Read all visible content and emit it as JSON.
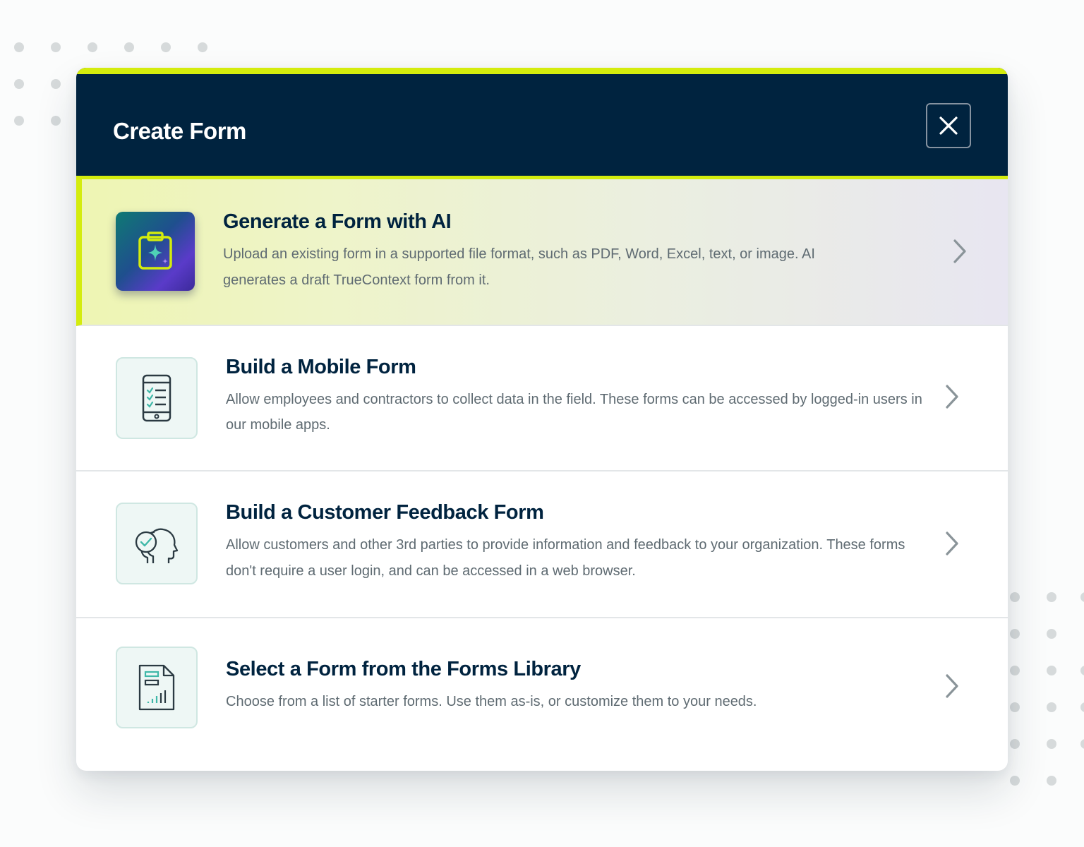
{
  "modal": {
    "title": "Create Form",
    "close_icon": "close-icon"
  },
  "options": [
    {
      "title": "Generate a Form with AI",
      "description": "Upload an existing form in a supported file format, such as PDF, Word, Excel, text, or image. AI generates a draft TrueContext form from it.",
      "icon": "ai-clipboard-sparkle-icon"
    },
    {
      "title": "Build a Mobile Form",
      "description": "Allow employees and contractors to collect data in the field. These forms can be accessed by logged-in users in our mobile apps.",
      "icon": "mobile-checklist-icon"
    },
    {
      "title": "Build a Customer Feedback Form",
      "description": "Allow customers and other 3rd parties to provide information and feedback to your organization. These forms don't require a user login, and can be accessed in a web browser.",
      "icon": "customer-feedback-icon"
    },
    {
      "title": "Select a Form from the Forms Library",
      "description": "Choose from a list of starter forms. Use them as-is, or customize them to your needs.",
      "icon": "forms-library-icon"
    }
  ],
  "colors": {
    "header_bg": "#00233f",
    "accent": "#d4ec0d",
    "title_text": "#00233f",
    "desc_text": "#5f6b72",
    "icon_teal": "#3fb8a8"
  }
}
